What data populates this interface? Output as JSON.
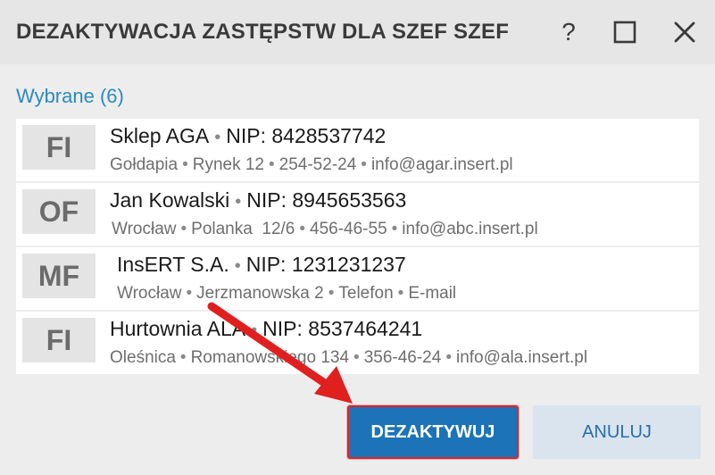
{
  "dialog": {
    "title": "DEZAKTYWACJA ZASTĘPSTW DLA SZEF SZEF",
    "help_glyph": "?"
  },
  "section": {
    "label": "Wybrane (6)"
  },
  "rows": [
    {
      "badge": "FI",
      "name": "Sklep AGA",
      "nip": "NIP: 8428537742",
      "city": "Gołdapia",
      "street": "Rynek 12",
      "phone": "254-52-24",
      "email": "info@agar.insert.pl"
    },
    {
      "badge": "OF",
      "name": "Jan Kowalski",
      "nip": "NIP: 8945653563",
      "city": "Wrocław",
      "street": "Polanka  12/6",
      "phone": "456-46-55",
      "email": "info@abc.insert.pl"
    },
    {
      "badge": "MF",
      "name": "InsERT S.A.",
      "nip": "NIP: 1231231237",
      "city": "Wrocław",
      "street": "Jerzmanowska 2",
      "phone": "Telefon",
      "email": "E-mail"
    },
    {
      "badge": "FI",
      "name": "Hurtownia ALA",
      "nip": "NIP: 8537464241",
      "city": "Oleśnica",
      "street": "Romanowskiego 134",
      "phone": "356-46-24",
      "email": "info@ala.insert.pl"
    }
  ],
  "buttons": {
    "deactivate_label": "DEZAKTYWUJ",
    "cancel_label": "ANULUJ"
  },
  "colors": {
    "accent": "#1c73b8",
    "highlight": "#d9262a",
    "label": "#2a8bbd"
  },
  "icons": [
    "help-icon",
    "maximize-icon",
    "close-icon",
    "arrow-annotation"
  ]
}
